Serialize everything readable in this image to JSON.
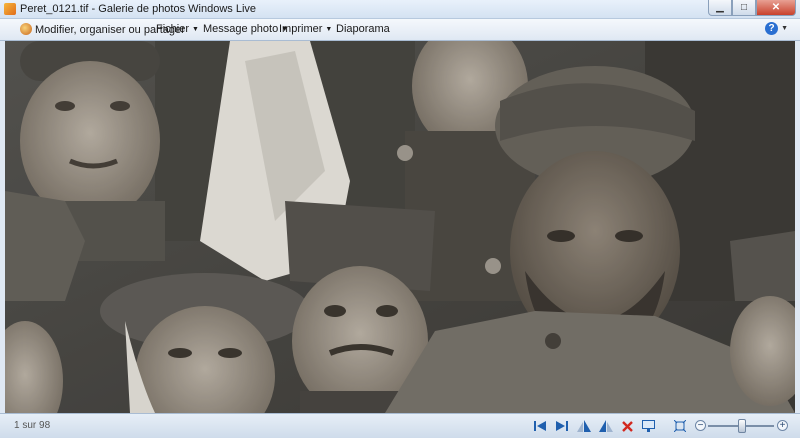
{
  "window": {
    "title": "Peret_0121.tif - Galerie de photos Windows Live",
    "minimize_icon": "minimize-icon",
    "maximize_icon": "maximize-icon",
    "close_icon": "close-icon"
  },
  "menubar": {
    "items": [
      {
        "label": "Modifier, organiser ou partager",
        "icon": "organize-icon",
        "dropdown": false
      },
      {
        "label": "Fichier",
        "dropdown": true
      },
      {
        "label": "Message photo",
        "dropdown": true
      },
      {
        "label": "Imprimer",
        "dropdown": true
      },
      {
        "label": "Diaporama",
        "dropdown": false
      }
    ],
    "help_icon": "help-icon",
    "help_glyph": "?"
  },
  "photo": {
    "subject": "sepia photograph of soldiers"
  },
  "statusbar": {
    "count": "1 sur 98",
    "controls": [
      "previous-icon",
      "next-icon",
      "rotate-left-icon",
      "rotate-right-icon",
      "delete-icon",
      "slideshow-icon",
      "fit-icon"
    ],
    "zoom_out_glyph": "−",
    "zoom_in_glyph": "+",
    "zoom_level": 0.5
  },
  "colors": {
    "accent": "#2a6fd1",
    "nav_blue": "#1f5fae",
    "delete_red": "#d2281f",
    "photo_tone": "#8b8175"
  }
}
